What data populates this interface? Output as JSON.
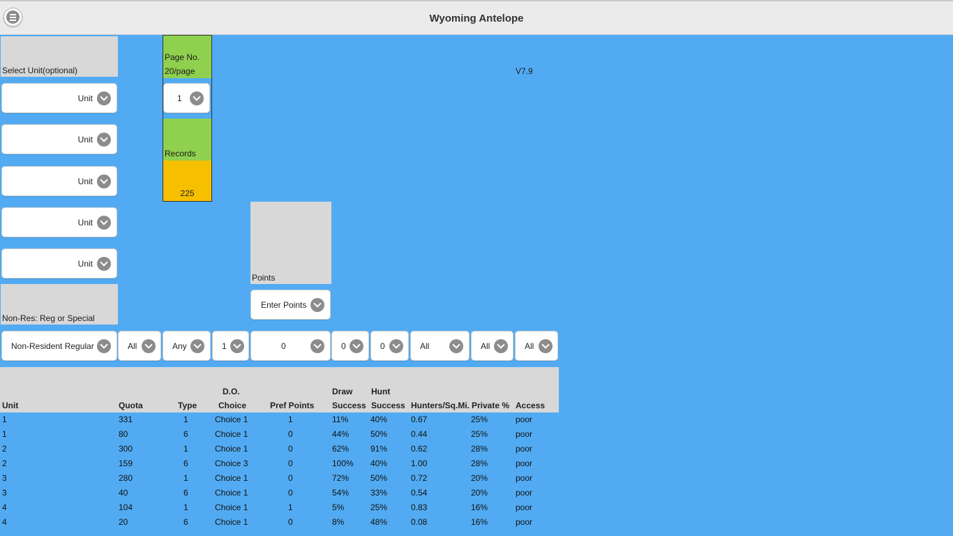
{
  "header": {
    "title": "Wyoming Antelope",
    "menu_icon": "hamburger-menu-icon"
  },
  "select_unit": {
    "label": "Select Unit(optional)",
    "dropdowns": [
      "Unit",
      "Unit",
      "Unit",
      "Unit",
      "Unit"
    ]
  },
  "page": {
    "label_line1": "Page No.",
    "label_line2": "20/page",
    "value": "1"
  },
  "records": {
    "label": "Records",
    "count": "225"
  },
  "version": "V7.9",
  "points": {
    "label": "Points",
    "dropdown": "Enter Points"
  },
  "residency": {
    "label": "Non-Res: Reg or Special"
  },
  "filters": [
    "Non-Resident Regular",
    "All",
    "Any",
    "1",
    "0",
    "0",
    "0",
    "All",
    "All",
    "All"
  ],
  "table": {
    "headers": {
      "unit": "Unit",
      "quota": "Quota",
      "type": "Type",
      "do_choice_1": "D.O.",
      "do_choice_2": "Choice",
      "pref_points": "Pref Points",
      "draw_1": "Draw",
      "draw_2": "Success",
      "hunt_1": "Hunt",
      "hunt_2": "Success",
      "hunters": "Hunters/Sq.Mi.",
      "private": "Private %",
      "access": "Access"
    },
    "rows": [
      [
        "1",
        "331",
        "1",
        "Choice 1",
        "1",
        "11%",
        "40%",
        "0.67",
        "25%",
        "poor"
      ],
      [
        "1",
        "80",
        "6",
        "Choice 1",
        "0",
        "44%",
        "50%",
        "0.44",
        "25%",
        "poor"
      ],
      [
        "2",
        "300",
        "1",
        "Choice 1",
        "0",
        "62%",
        "91%",
        "0.62",
        "28%",
        "poor"
      ],
      [
        "2",
        "159",
        "6",
        "Choice 3",
        "0",
        "100%",
        "40%",
        "1.00",
        "28%",
        "poor"
      ],
      [
        "3",
        "280",
        "1",
        "Choice 1",
        "0",
        "72%",
        "50%",
        "0.72",
        "20%",
        "poor"
      ],
      [
        "3",
        "40",
        "6",
        "Choice 1",
        "0",
        "54%",
        "33%",
        "0.54",
        "20%",
        "poor"
      ],
      [
        "4",
        "104",
        "1",
        "Choice 1",
        "1",
        "5%",
        "25%",
        "0.83",
        "16%",
        "poor"
      ],
      [
        "4",
        "20",
        "6",
        "Choice 1",
        "0",
        "8%",
        "48%",
        "0.08",
        "16%",
        "poor"
      ]
    ]
  },
  "colors": {
    "background": "#52abf2",
    "header": "#ebebeb",
    "panel": "#d8d8d8",
    "green": "#8fd14f",
    "yellow": "#f6c000"
  }
}
